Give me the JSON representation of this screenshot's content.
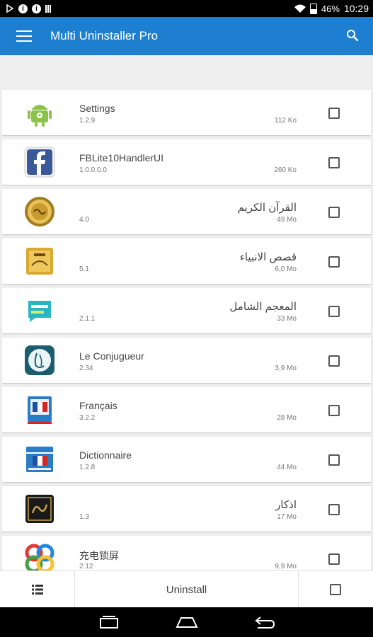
{
  "status_bar": {
    "battery": "46%",
    "time": "10:29"
  },
  "header": {
    "title": "Multi Uninstaller Pro"
  },
  "apps": [
    {
      "name": "Settings",
      "version": "1.2.9",
      "size": "112 Ko",
      "rtl": false
    },
    {
      "name": "FBLite10HandlerUI",
      "version": "1.0.0.0.0",
      "size": "260 Ko",
      "rtl": false
    },
    {
      "name": "القرآن الكريم",
      "version": "4.0",
      "size": "49 Mo",
      "rtl": true
    },
    {
      "name": "قصص الانبياء",
      "version": "5.1",
      "size": "6,0 Mo",
      "rtl": true
    },
    {
      "name": "المعجم الشامل",
      "version": "2.1.1",
      "size": "33 Mo",
      "rtl": true
    },
    {
      "name": "Le Conjugueur",
      "version": "2.34",
      "size": "3,9 Mo",
      "rtl": false
    },
    {
      "name": "Français",
      "version": "3.2.2",
      "size": "28 Mo",
      "rtl": false
    },
    {
      "name": "Dictionnaire",
      "version": "1.2.8",
      "size": "44 Mo",
      "rtl": false
    },
    {
      "name": "اذكار",
      "version": "1.3",
      "size": "17 Mo",
      "rtl": true
    },
    {
      "name": "充电锁屏",
      "version": "2.12",
      "size": "9,9 Mo",
      "rtl": false
    }
  ],
  "bottom_bar": {
    "uninstall_label": "Uninstall"
  },
  "colors": {
    "app_bar": "#1e7fd0",
    "background": "#eeeeee"
  }
}
